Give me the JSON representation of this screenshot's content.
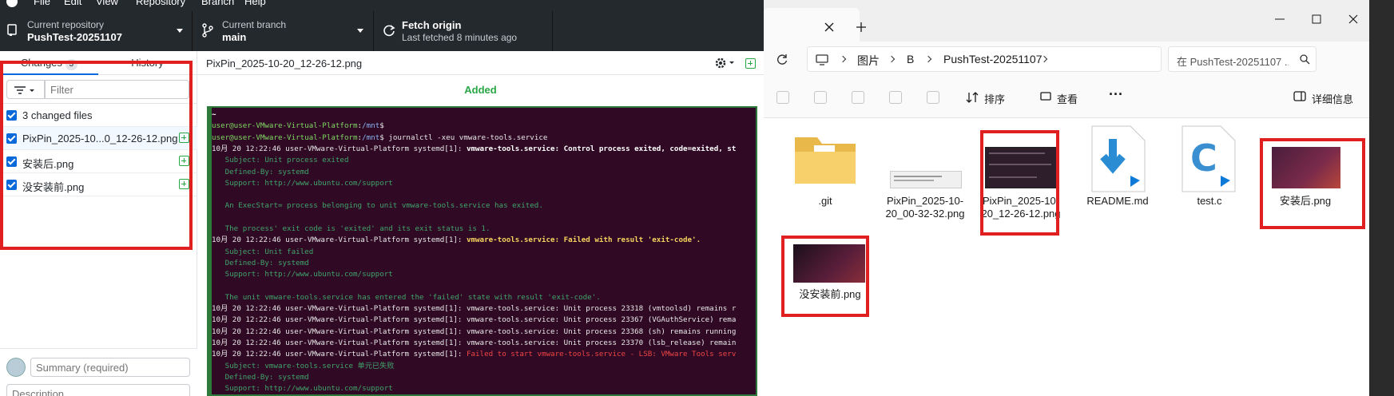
{
  "github": {
    "menu": [
      "File",
      "Edit",
      "View",
      "Repository",
      "Branch",
      "Help"
    ],
    "repo": {
      "label": "Current repository",
      "value": "PushTest-20251107"
    },
    "branch": {
      "label": "Current branch",
      "value": "main"
    },
    "fetch": {
      "label": "Fetch origin",
      "sub": "Last fetched 8 minutes ago"
    },
    "tabs": {
      "changes": "Changes",
      "changes_count": "3",
      "history": "History"
    },
    "filter_placeholder": "Filter",
    "changed_files_label": "3 changed files",
    "files": [
      "PixPin_2025-10...0_12-26-12.png",
      "安装后.png",
      "没安装前.png"
    ],
    "diff": {
      "filename": "PixPin_2025-10-20_12-26-12.png",
      "status": "Added"
    },
    "summary_placeholder": "Summary (required)",
    "description_placeholder": "Description"
  },
  "terminal": {
    "lines": [
      {
        "segs": [
          {
            "t": "~",
            "c": "w"
          }
        ]
      },
      {
        "segs": [
          {
            "t": "user@user-VMware-Virtual-Platform",
            "c": "g"
          },
          {
            "t": ":",
            "c": ""
          },
          {
            "t": "/mnt",
            "c": "b"
          },
          {
            "t": "$",
            "c": ""
          }
        ]
      },
      {
        "segs": [
          {
            "t": "user@user-VMware-Virtual-Platform",
            "c": "g"
          },
          {
            "t": ":",
            "c": ""
          },
          {
            "t": "/mnt",
            "c": "b"
          },
          {
            "t": "$ journalctl -xeu vmware-tools.service",
            "c": ""
          }
        ]
      },
      {
        "segs": [
          {
            "t": "10月 20 12:22:46 user-VMware-Virtual-Platform systemd[1]: ",
            "c": ""
          },
          {
            "t": "vmware-tools.service: Control process exited, code=exited, st",
            "c": "w"
          }
        ]
      },
      {
        "segs": [
          {
            "t": "   Subject: Unit process exited",
            "c": "d"
          }
        ]
      },
      {
        "segs": [
          {
            "t": "   Defined-By: systemd",
            "c": "d"
          }
        ]
      },
      {
        "segs": [
          {
            "t": "   Support: http://www.ubuntu.com/support",
            "c": "d"
          }
        ]
      },
      {
        "segs": [
          {
            "t": "",
            "c": ""
          }
        ]
      },
      {
        "segs": [
          {
            "t": "   An ExecStart= process belonging to unit vmware-tools.service has exited.",
            "c": "d"
          }
        ]
      },
      {
        "segs": [
          {
            "t": "",
            "c": ""
          }
        ]
      },
      {
        "segs": [
          {
            "t": "   The process' exit code is 'exited' and its exit status is 1.",
            "c": "d"
          }
        ]
      },
      {
        "segs": [
          {
            "t": "10月 20 12:22:46 user-VMware-Virtual-Platform systemd[1]: ",
            "c": ""
          },
          {
            "t": "vmware-tools.service: Failed with result 'exit-code'.",
            "c": "y"
          }
        ]
      },
      {
        "segs": [
          {
            "t": "   Subject: Unit failed",
            "c": "d"
          }
        ]
      },
      {
        "segs": [
          {
            "t": "   Defined-By: systemd",
            "c": "d"
          }
        ]
      },
      {
        "segs": [
          {
            "t": "   Support: http://www.ubuntu.com/support",
            "c": "d"
          }
        ]
      },
      {
        "segs": [
          {
            "t": "",
            "c": ""
          }
        ]
      },
      {
        "segs": [
          {
            "t": "   The unit vmware-tools.service has entered the 'failed' state with result 'exit-code'.",
            "c": "d"
          }
        ]
      },
      {
        "segs": [
          {
            "t": "10月 20 12:22:46 user-VMware-Virtual-Platform systemd[1]: vmware-tools.service: Unit process 23318 (vmtoolsd) remains r",
            "c": ""
          }
        ]
      },
      {
        "segs": [
          {
            "t": "10月 20 12:22:46 user-VMware-Virtual-Platform systemd[1]: vmware-tools.service: Unit process 23367 (VGAuthService) rema",
            "c": ""
          }
        ]
      },
      {
        "segs": [
          {
            "t": "10月 20 12:22:46 user-VMware-Virtual-Platform systemd[1]: vmware-tools.service: Unit process 23368 (sh) remains running",
            "c": ""
          }
        ]
      },
      {
        "segs": [
          {
            "t": "10月 20 12:22:46 user-VMware-Virtual-Platform systemd[1]: vmware-tools.service: Unit process 23370 (lsb_release) remain",
            "c": ""
          }
        ]
      },
      {
        "segs": [
          {
            "t": "10月 20 12:22:46 user-VMware-Virtual-Platform systemd[1]: ",
            "c": ""
          },
          {
            "t": "Failed to start vmware-tools.service - LSB: VMware Tools serv",
            "c": "r"
          }
        ]
      },
      {
        "segs": [
          {
            "t": "   Subject: vmware-tools.service 单元已失败",
            "c": "d"
          }
        ]
      },
      {
        "segs": [
          {
            "t": "   Defined-By: systemd",
            "c": "d"
          }
        ]
      },
      {
        "segs": [
          {
            "t": "   Support: http://www.ubuntu.com/support",
            "c": "d"
          }
        ]
      }
    ]
  },
  "explorer": {
    "breadcrumb": [
      "图片",
      "B",
      "PushTest-20251107"
    ],
    "search_placeholder": "在 PushTest-20251107 ...",
    "sort_label": "排序",
    "view_label": "查看",
    "more_label": "···",
    "details_label": "详细信息",
    "files": [
      {
        "name": ".git",
        "type": "folder"
      },
      {
        "name": "PixPin_2025-10-20_00-32-32.png",
        "type": "image-light"
      },
      {
        "name": "PixPin_2025-10-20_12-26-12.png",
        "type": "image-dark"
      },
      {
        "name": "README.md",
        "type": "markdown"
      },
      {
        "name": "test.c",
        "type": "c-source"
      },
      {
        "name": "安装后.png",
        "type": "image-ubuntu"
      },
      {
        "name": "没安装前.png",
        "type": "image-ubuntu"
      }
    ]
  },
  "colors": {
    "accent": "#0969da",
    "added": "#28a745",
    "highlight": "#e02020",
    "terminal_bg": "#300a24"
  }
}
